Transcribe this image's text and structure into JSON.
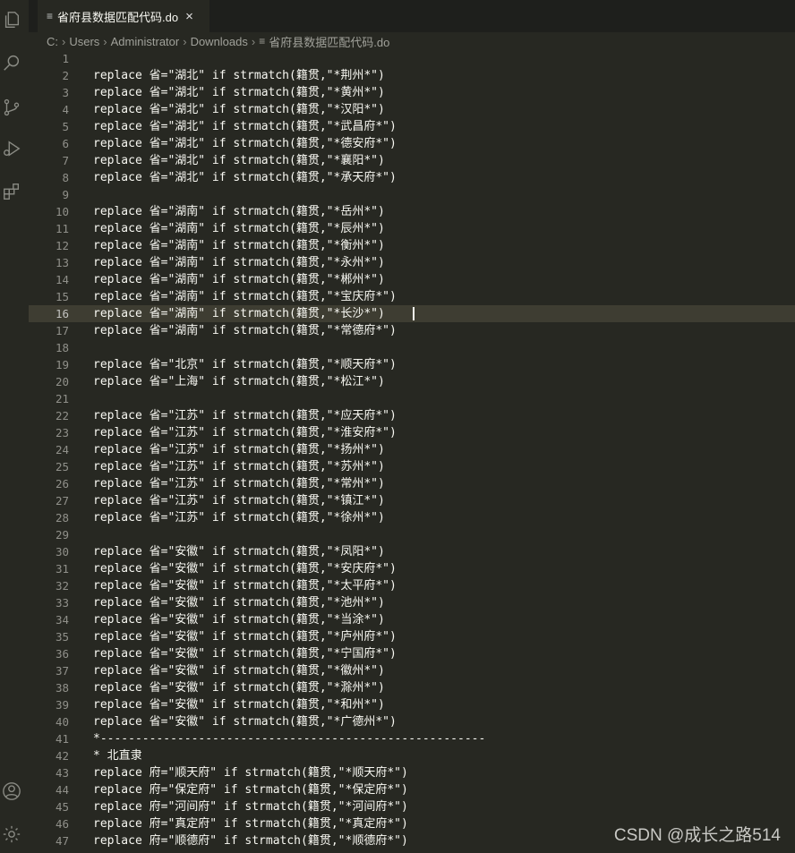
{
  "tab": {
    "title": "省府县数据匹配代码.do",
    "close": "×",
    "file_icon": "≡"
  },
  "breadcrumb": [
    "C:",
    "Users",
    "Administrator",
    "Downloads",
    "省府县数据匹配代码.do"
  ],
  "activity_bar": [
    "files-icon",
    "search-icon",
    "source-control-icon",
    "run-debug-icon",
    "extensions-icon",
    "account-icon",
    "settings-gear-icon"
  ],
  "lines": [
    {
      "n": "1",
      "text": ""
    },
    {
      "n": "2",
      "text": "replace 省=\"湖北\" if strmatch(籍贯,\"*荆州*\")"
    },
    {
      "n": "3",
      "text": "replace 省=\"湖北\" if strmatch(籍贯,\"*黄州*\")"
    },
    {
      "n": "4",
      "text": "replace 省=\"湖北\" if strmatch(籍贯,\"*汉阳*\")"
    },
    {
      "n": "5",
      "text": "replace 省=\"湖北\" if strmatch(籍贯,\"*武昌府*\")"
    },
    {
      "n": "6",
      "text": "replace 省=\"湖北\" if strmatch(籍贯,\"*德安府*\")"
    },
    {
      "n": "7",
      "text": "replace 省=\"湖北\" if strmatch(籍贯,\"*襄阳*\")"
    },
    {
      "n": "8",
      "text": "replace 省=\"湖北\" if strmatch(籍贯,\"*承天府*\")"
    },
    {
      "n": "9",
      "text": ""
    },
    {
      "n": "10",
      "text": "replace 省=\"湖南\" if strmatch(籍贯,\"*岳州*\")"
    },
    {
      "n": "11",
      "text": "replace 省=\"湖南\" if strmatch(籍贯,\"*辰州*\")"
    },
    {
      "n": "12",
      "text": "replace 省=\"湖南\" if strmatch(籍贯,\"*衡州*\")"
    },
    {
      "n": "13",
      "text": "replace 省=\"湖南\" if strmatch(籍贯,\"*永州*\")"
    },
    {
      "n": "14",
      "text": "replace 省=\"湖南\" if strmatch(籍贯,\"*郴州*\")"
    },
    {
      "n": "15",
      "text": "replace 省=\"湖南\" if strmatch(籍贯,\"*宝庆府*\")"
    },
    {
      "n": "16",
      "text": "replace 省=\"湖南\" if strmatch(籍贯,\"*长沙*\")",
      "current": true
    },
    {
      "n": "17",
      "text": "replace 省=\"湖南\" if strmatch(籍贯,\"*常德府*\")"
    },
    {
      "n": "18",
      "text": ""
    },
    {
      "n": "19",
      "text": "replace 省=\"北京\" if strmatch(籍贯,\"*顺天府*\")"
    },
    {
      "n": "20",
      "text": "replace 省=\"上海\" if strmatch(籍贯,\"*松江*\")"
    },
    {
      "n": "21",
      "text": ""
    },
    {
      "n": "22",
      "text": "replace 省=\"江苏\" if strmatch(籍贯,\"*应天府*\")"
    },
    {
      "n": "23",
      "text": "replace 省=\"江苏\" if strmatch(籍贯,\"*淮安府*\")"
    },
    {
      "n": "24",
      "text": "replace 省=\"江苏\" if strmatch(籍贯,\"*扬州*\")"
    },
    {
      "n": "25",
      "text": "replace 省=\"江苏\" if strmatch(籍贯,\"*苏州*\")"
    },
    {
      "n": "26",
      "text": "replace 省=\"江苏\" if strmatch(籍贯,\"*常州*\")"
    },
    {
      "n": "27",
      "text": "replace 省=\"江苏\" if strmatch(籍贯,\"*镇江*\")"
    },
    {
      "n": "28",
      "text": "replace 省=\"江苏\" if strmatch(籍贯,\"*徐州*\")"
    },
    {
      "n": "29",
      "text": ""
    },
    {
      "n": "30",
      "text": "replace 省=\"安徽\" if strmatch(籍贯,\"*凤阳*\")"
    },
    {
      "n": "31",
      "text": "replace 省=\"安徽\" if strmatch(籍贯,\"*安庆府*\")"
    },
    {
      "n": "32",
      "text": "replace 省=\"安徽\" if strmatch(籍贯,\"*太平府*\")"
    },
    {
      "n": "33",
      "text": "replace 省=\"安徽\" if strmatch(籍贯,\"*池州*\")"
    },
    {
      "n": "34",
      "text": "replace 省=\"安徽\" if strmatch(籍贯,\"*当涂*\")"
    },
    {
      "n": "35",
      "text": "replace 省=\"安徽\" if strmatch(籍贯,\"*庐州府*\")"
    },
    {
      "n": "36",
      "text": "replace 省=\"安徽\" if strmatch(籍贯,\"*宁国府*\")"
    },
    {
      "n": "37",
      "text": "replace 省=\"安徽\" if strmatch(籍贯,\"*徽州*\")"
    },
    {
      "n": "38",
      "text": "replace 省=\"安徽\" if strmatch(籍贯,\"*滁州*\")"
    },
    {
      "n": "39",
      "text": "replace 省=\"安徽\" if strmatch(籍贯,\"*和州*\")"
    },
    {
      "n": "40",
      "text": "replace 省=\"安徽\" if strmatch(籍贯,\"*广德州*\")"
    },
    {
      "n": "41",
      "text": "*-------------------------------------------------------"
    },
    {
      "n": "42",
      "text": "* 北直隶"
    },
    {
      "n": "43",
      "text": "replace 府=\"顺天府\" if strmatch(籍贯,\"*顺天府*\")"
    },
    {
      "n": "44",
      "text": "replace 府=\"保定府\" if strmatch(籍贯,\"*保定府*\")"
    },
    {
      "n": "45",
      "text": "replace 府=\"河间府\" if strmatch(籍贯,\"*河间府*\")"
    },
    {
      "n": "46",
      "text": "replace 府=\"真定府\" if strmatch(籍贯,\"*真定府*\")"
    },
    {
      "n": "47",
      "text": "replace 府=\"顺德府\" if strmatch(籍贯,\"*顺德府*\")"
    }
  ],
  "watermark": "CSDN @成长之路514"
}
